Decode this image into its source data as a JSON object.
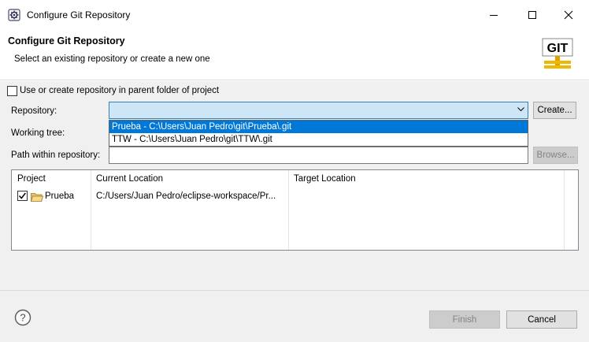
{
  "window": {
    "title": "Configure Git Repository",
    "app_icon": "eclipse-gear-icon",
    "controls": [
      "minimize-icon",
      "maximize-icon",
      "close-icon"
    ]
  },
  "header": {
    "title": "Configure Git Repository",
    "description": "Select an existing repository or create a new one",
    "logo_text": "GIT"
  },
  "form": {
    "parent_folder_checkbox": {
      "label": "Use or create repository in parent folder of project",
      "checked": false
    },
    "repository": {
      "label": "Repository:",
      "value": "",
      "options": [
        "Prueba - C:\\Users\\Juan Pedro\\git\\Prueba\\.git",
        "TTW - C:\\Users\\Juan Pedro\\git\\TTW\\.git"
      ],
      "selected_index": 0,
      "create_button": "Create..."
    },
    "working_tree": {
      "label": "Working tree:"
    },
    "path_within_repository": {
      "label": "Path within repository:",
      "value": "",
      "browse_button": "Browse..."
    }
  },
  "table": {
    "columns": [
      "Project",
      "Current Location",
      "Target Location"
    ],
    "rows": [
      {
        "checked": true,
        "project": "Prueba",
        "current_location": "C:/Users/Juan Pedro/eclipse-workspace/Pr...",
        "target_location": ""
      }
    ]
  },
  "footer": {
    "help_icon": "help-icon",
    "finish_button": "Finish",
    "cancel_button": "Cancel"
  },
  "colors": {
    "selection": "#0078d7",
    "combo_focus_bg": "#cde6f7",
    "dialog_bg": "#f0f0f0"
  }
}
